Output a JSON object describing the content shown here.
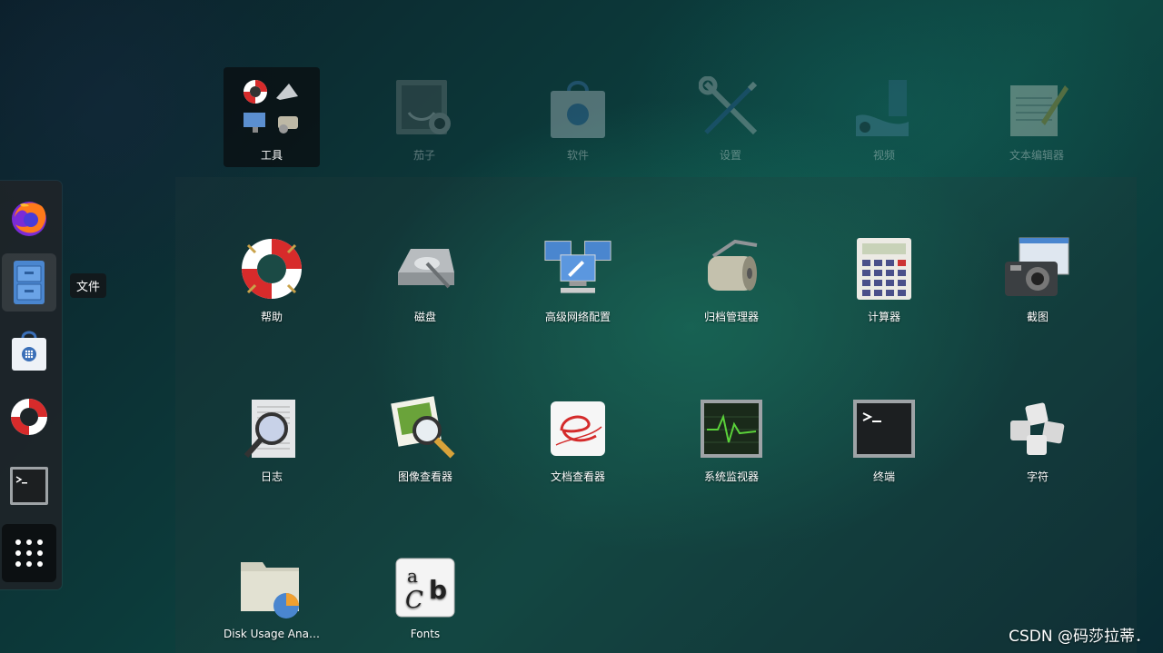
{
  "dash": {
    "items": [
      "firefox",
      "files",
      "software",
      "help",
      "terminal"
    ],
    "tooltip": "文件"
  },
  "folders": [
    {
      "label": "工具",
      "selected": true
    },
    {
      "label": "茄子"
    },
    {
      "label": "软件"
    },
    {
      "label": "设置"
    },
    {
      "label": "视频"
    },
    {
      "label": "文本编辑器"
    }
  ],
  "apps": [
    {
      "label": "帮助",
      "icon": "lifebuoy-icon"
    },
    {
      "label": "磁盘",
      "icon": "hard-disk-icon"
    },
    {
      "label": "高级网络配置",
      "icon": "network-icon"
    },
    {
      "label": "归档管理器",
      "icon": "archive-roller-icon"
    },
    {
      "label": "计算器",
      "icon": "calculator-icon"
    },
    {
      "label": "截图",
      "icon": "camera-icon"
    },
    {
      "label": "日志",
      "icon": "logs-icon"
    },
    {
      "label": "图像查看器",
      "icon": "image-viewer-icon"
    },
    {
      "label": "文档查看器",
      "icon": "document-viewer-icon"
    },
    {
      "label": "系统监视器",
      "icon": "system-monitor-icon"
    },
    {
      "label": "终端",
      "icon": "terminal-icon"
    },
    {
      "label": "字符",
      "icon": "characters-icon"
    },
    {
      "label": "Disk Usage Ana…",
      "icon": "disk-usage-icon"
    },
    {
      "label": "Fonts",
      "icon": "fonts-icon"
    }
  ],
  "watermark": "CSDN @码莎拉蒂．"
}
